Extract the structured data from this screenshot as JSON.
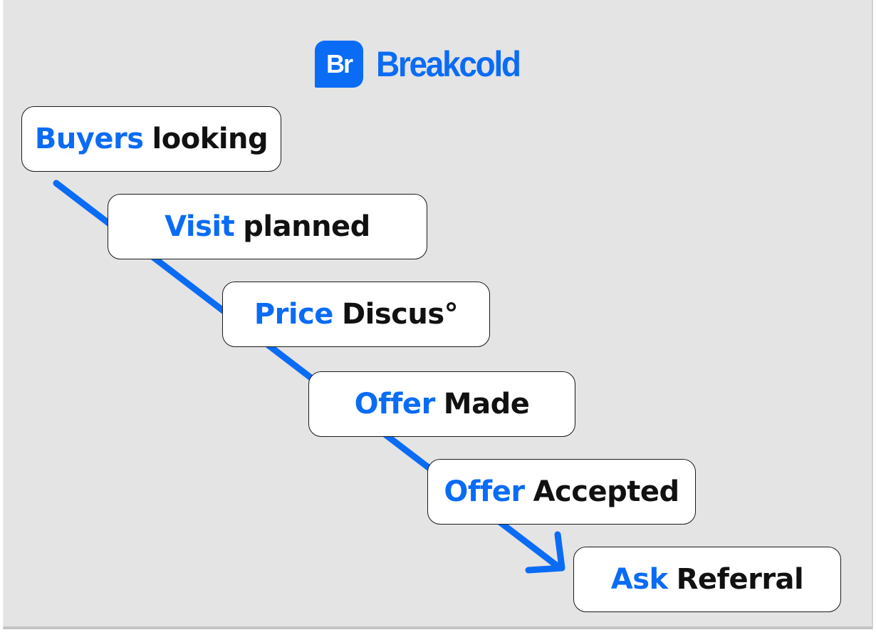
{
  "brand": {
    "mark": "Br",
    "name": "Breakcold",
    "color": "#0a6cf5"
  },
  "colors": {
    "accent": "#0a6cf5",
    "background": "#e4e4e4",
    "box_fill": "#ffffff",
    "box_border": "#1a1a1a",
    "text": "#111111"
  },
  "diagram": {
    "type": "pipeline-staircase",
    "connector": "arrow",
    "steps": [
      {
        "keyword": "Buyers",
        "rest": "looking"
      },
      {
        "keyword": "Visit",
        "rest": "planned"
      },
      {
        "keyword": "Price",
        "rest": "Discus°"
      },
      {
        "keyword": "Offer",
        "rest": "Made"
      },
      {
        "keyword": "Offer",
        "rest": "Accepted"
      },
      {
        "keyword": "Ask",
        "rest": "Referral"
      }
    ]
  }
}
